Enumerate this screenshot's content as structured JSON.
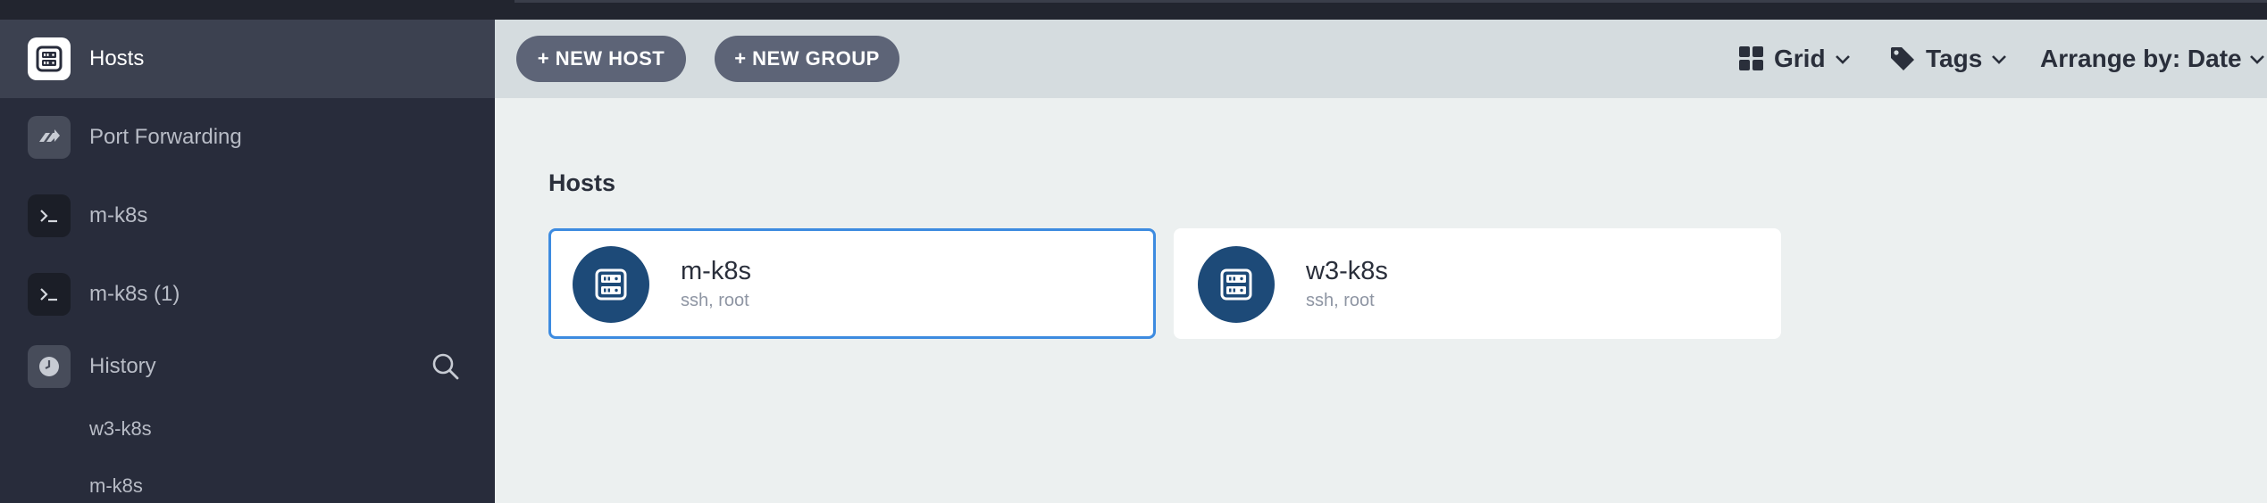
{
  "sidebar": {
    "items": [
      {
        "label": "Hosts",
        "icon": "server-icon"
      },
      {
        "label": "Port Forwarding",
        "icon": "port-forwarding-icon"
      },
      {
        "label": "m-k8s",
        "icon": "terminal-icon"
      },
      {
        "label": "m-k8s (1)",
        "icon": "terminal-icon"
      },
      {
        "label": "History",
        "icon": "clock-icon"
      }
    ],
    "history": [
      "w3-k8s",
      "m-k8s"
    ]
  },
  "toolbar": {
    "new_host": "+ NEW HOST",
    "new_group": "+ NEW GROUP",
    "view": "Grid",
    "tags": "Tags",
    "arrange": "Arrange by: Date"
  },
  "main": {
    "section_title": "Hosts",
    "hosts": [
      {
        "name": "m-k8s",
        "sub": "ssh, root",
        "selected": true
      },
      {
        "name": "w3-k8s",
        "sub": "ssh, root",
        "selected": false
      }
    ]
  },
  "colors": {
    "sidebar_bg": "#282c3b",
    "accent": "#3d8be0",
    "avatar_bg": "#1d4a78",
    "pill_bg": "#5d6477"
  }
}
